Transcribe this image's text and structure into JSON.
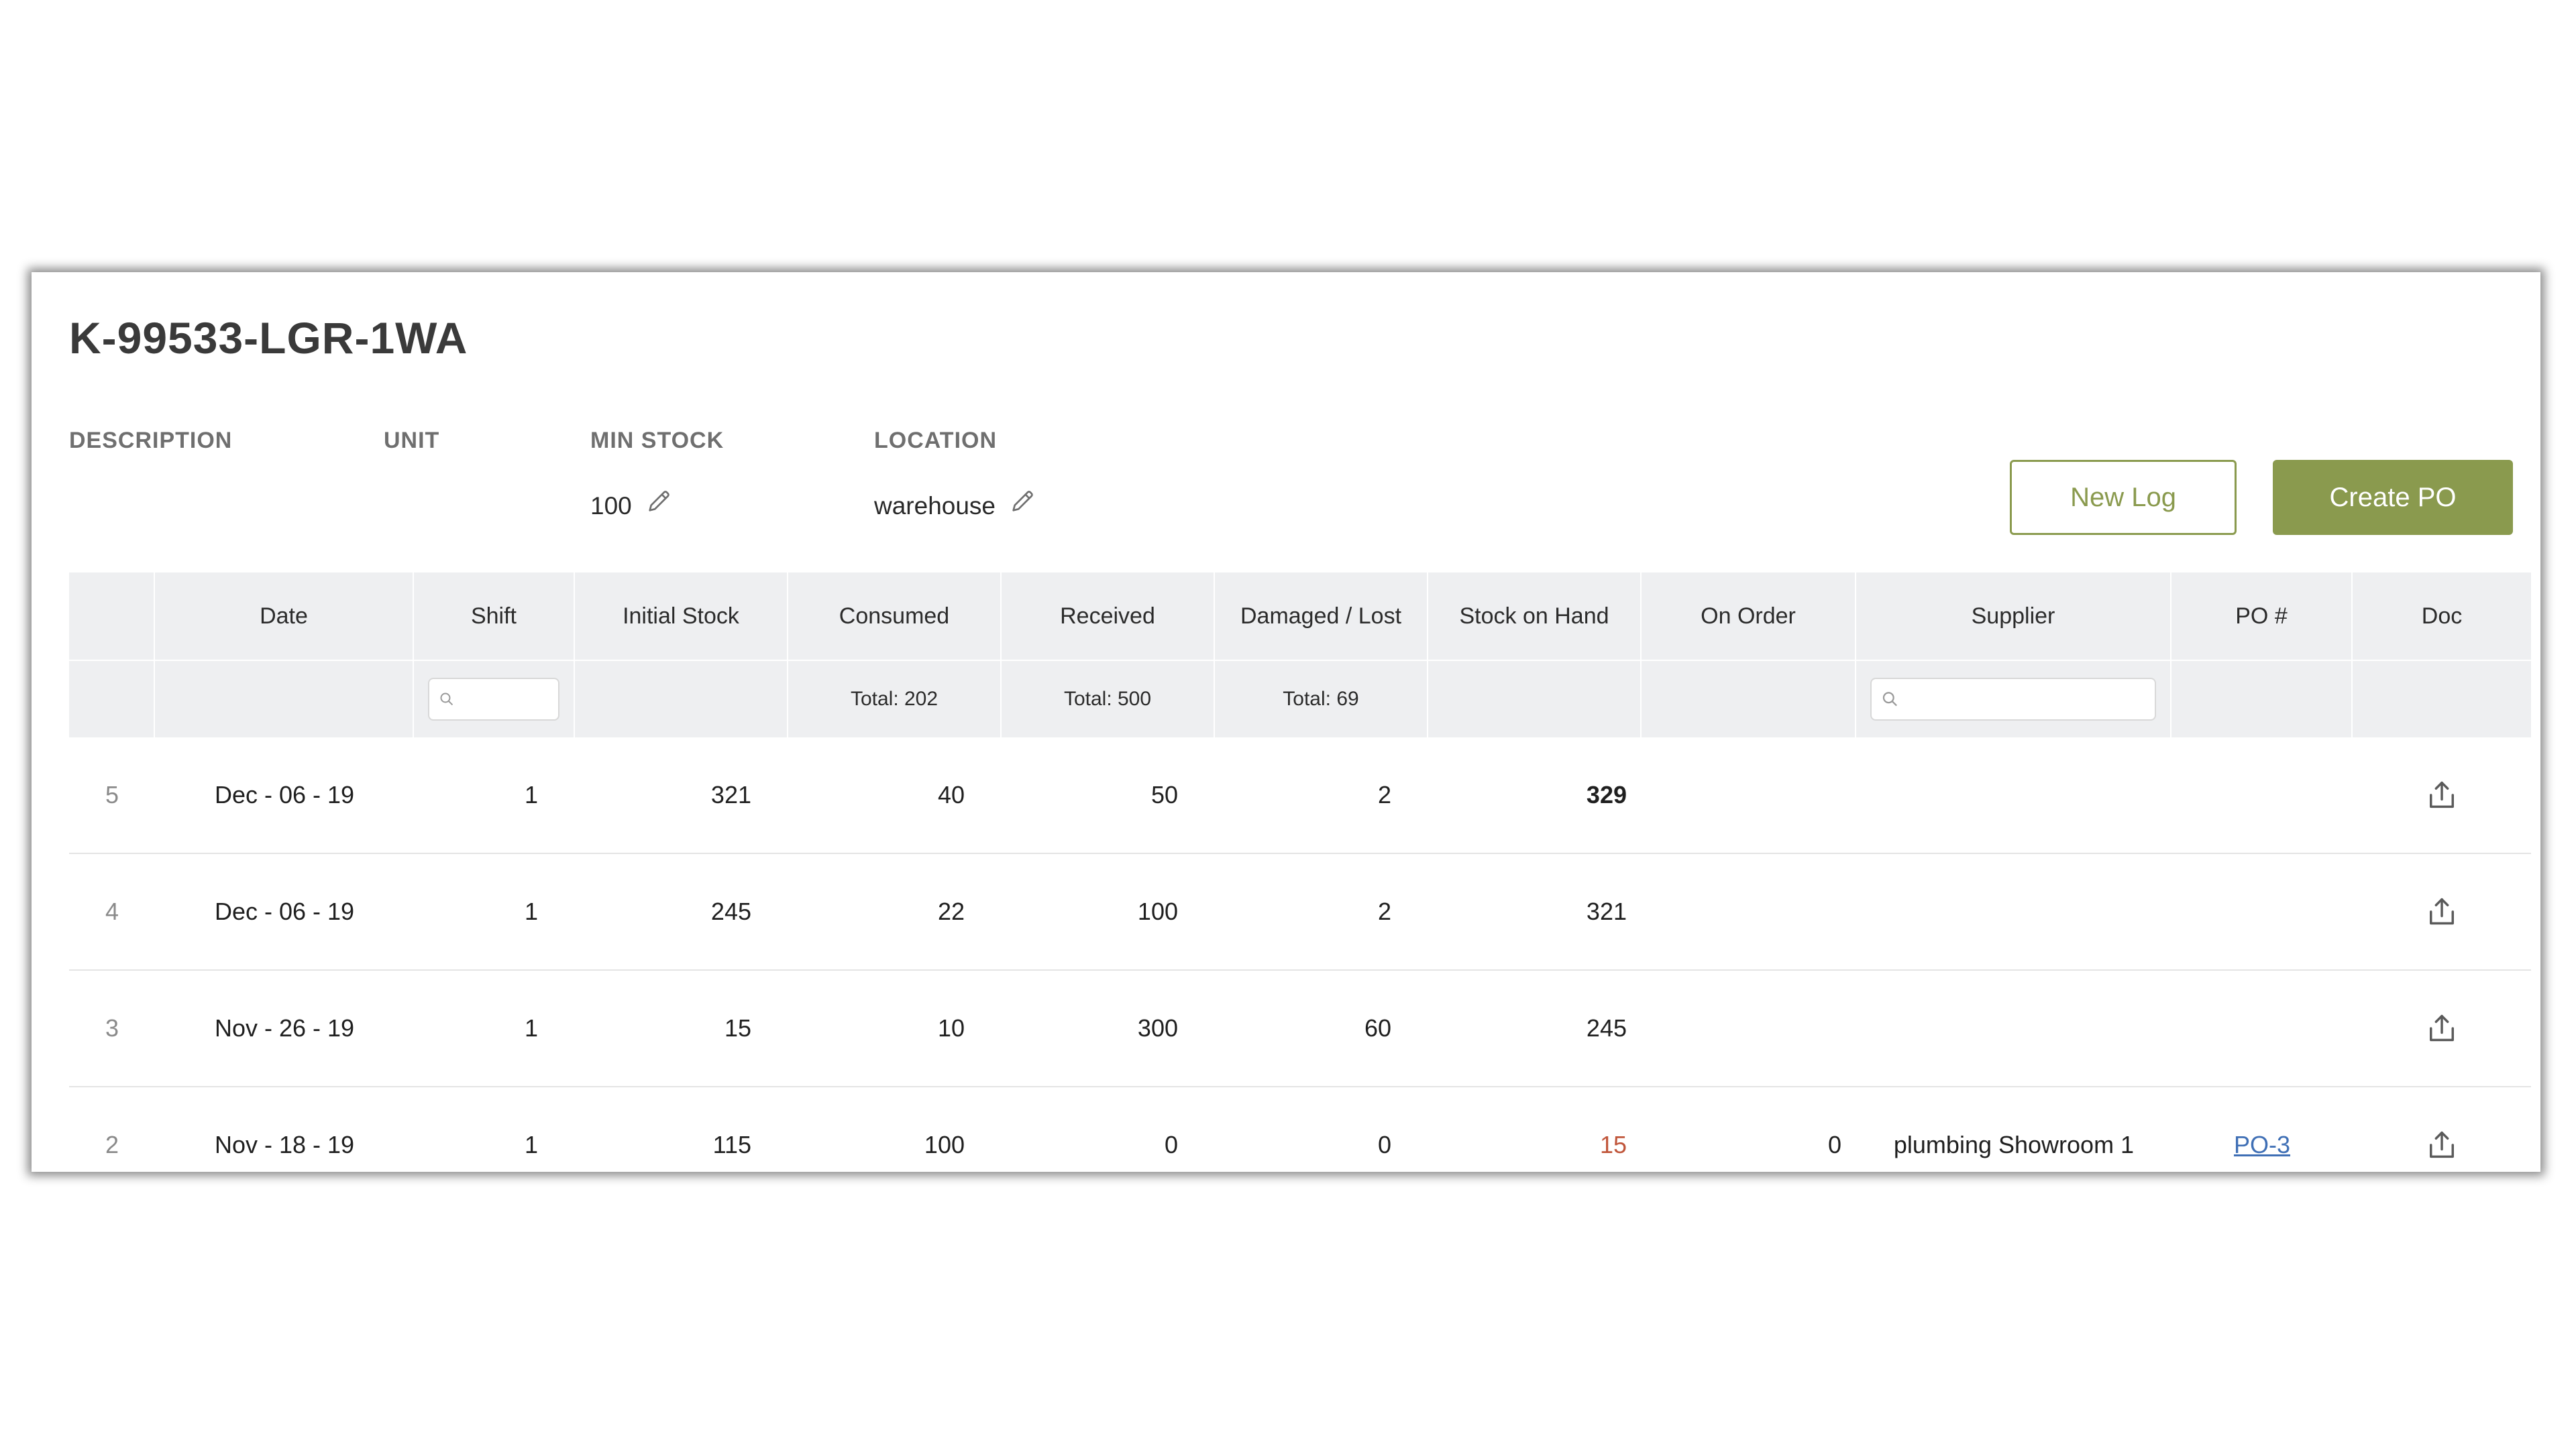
{
  "item": {
    "title": "K-99533-LGR-1WA",
    "fields": {
      "description_label": "DESCRIPTION",
      "unit_label": "UNIT",
      "min_stock_label": "MIN STOCK",
      "min_stock_value": "100",
      "location_label": "LOCATION",
      "location_value": "warehouse"
    }
  },
  "actions": {
    "new_log": "New Log",
    "create_po": "Create PO"
  },
  "colors": {
    "accent": "#8a9a4e",
    "header_bg": "#eeeff1",
    "alert": "#c0553a",
    "link": "#3f6fb5"
  },
  "table": {
    "columns": {
      "index": "",
      "date": "Date",
      "shift": "Shift",
      "initial_stock": "Initial Stock",
      "consumed": "Consumed",
      "received": "Received",
      "damaged_lost": "Damaged / Lost",
      "stock_on_hand": "Stock on Hand",
      "on_order": "On Order",
      "supplier": "Supplier",
      "po": "PO #",
      "doc": "Doc"
    },
    "totals": {
      "consumed": "Total: 202",
      "received": "Total: 500",
      "damaged_lost": "Total: 69"
    },
    "rows": [
      {
        "index": "5",
        "date": "Dec - 06 - 19",
        "shift": "1",
        "initial_stock": "321",
        "consumed": "40",
        "received": "50",
        "damaged_lost": "2",
        "stock_on_hand": "329",
        "on_order": "",
        "supplier": "",
        "po": "",
        "doc_icon": "upload-icon"
      },
      {
        "index": "4",
        "date": "Dec - 06 - 19",
        "shift": "1",
        "initial_stock": "245",
        "consumed": "22",
        "received": "100",
        "damaged_lost": "2",
        "stock_on_hand": "321",
        "on_order": "",
        "supplier": "",
        "po": "",
        "doc_icon": "upload-icon"
      },
      {
        "index": "3",
        "date": "Nov - 26 - 19",
        "shift": "1",
        "initial_stock": "15",
        "consumed": "10",
        "received": "300",
        "damaged_lost": "60",
        "stock_on_hand": "245",
        "on_order": "",
        "supplier": "",
        "po": "",
        "doc_icon": "upload-icon"
      },
      {
        "index": "2",
        "date": "Nov - 18 - 19",
        "shift": "1",
        "initial_stock": "115",
        "consumed": "100",
        "received": "0",
        "damaged_lost": "0",
        "stock_on_hand": "15",
        "on_order": "0",
        "supplier": "plumbing Showroom 1",
        "po": "PO-3",
        "doc_icon": "upload-icon"
      }
    ]
  }
}
